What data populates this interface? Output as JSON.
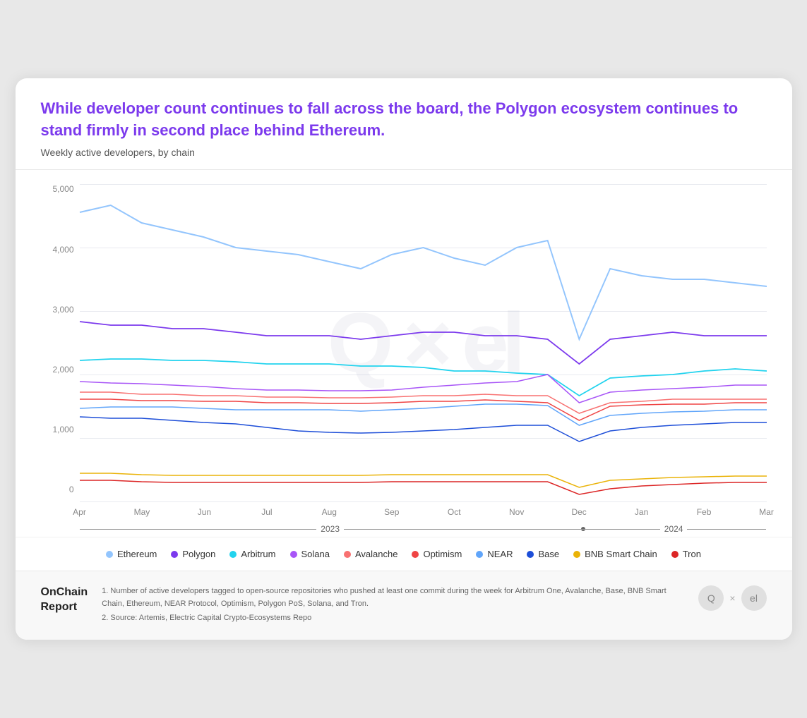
{
  "card": {
    "title": "While developer count continues to fall across the board, the Polygon ecosystem continues to stand firmly in second place behind Ethereum.",
    "subtitle": "Weekly active developers, by chain"
  },
  "yAxis": {
    "labels": [
      "5,000",
      "4,000",
      "3,000",
      "2,000",
      "1,000",
      "0"
    ]
  },
  "xAxis": {
    "labels": [
      "Apr",
      "May",
      "Jun",
      "Jul",
      "Aug",
      "Sep",
      "Oct",
      "Nov",
      "Dec",
      "Jan",
      "Feb",
      "Mar"
    ],
    "years": [
      "2023",
      "2024"
    ]
  },
  "legend": [
    {
      "name": "Ethereum",
      "color": "#93c5fd"
    },
    {
      "name": "Polygon",
      "color": "#7c3aed"
    },
    {
      "name": "Arbitrum",
      "color": "#22d3ee"
    },
    {
      "name": "Solana",
      "color": "#a855f7"
    },
    {
      "name": "Avalanche",
      "color": "#f87171"
    },
    {
      "name": "Optimism",
      "color": "#ef4444"
    },
    {
      "name": "NEAR",
      "color": "#60a5fa"
    },
    {
      "name": "Base",
      "color": "#1d4ed8"
    },
    {
      "name": "BNB Smart Chain",
      "color": "#eab308"
    },
    {
      "name": "Tron",
      "color": "#dc2626"
    }
  ],
  "footer": {
    "brand": "OnChain\nReport",
    "note1": "1. Number of active developers tagged to open-source repositories who pushed at least one commit during the week for Arbitrum One, Avalanche, Base, BNB Smart Chain, Ethereum, NEAR Protocol, Optimism, Polygon PoS, Solana, and Tron.",
    "note2": "2. Source: Artemis, Electric Capital Crypto-Ecosystems Repo"
  },
  "watermark": "Q × el"
}
